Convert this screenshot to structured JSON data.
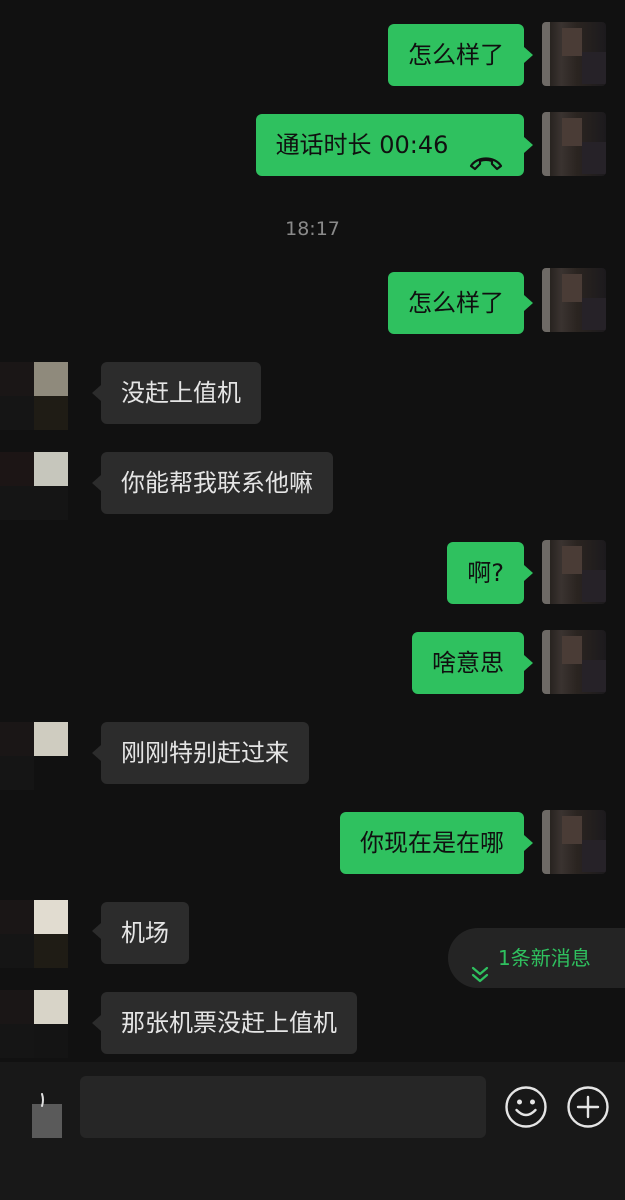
{
  "messages": [
    {
      "side": "sent",
      "text": "怎么样了"
    },
    {
      "side": "sent",
      "text": "通话时长 00:46",
      "icon": "phone-hangup-icon"
    },
    {
      "side": "sent",
      "text": "怎么样了"
    },
    {
      "side": "received",
      "text": "没赶上值机"
    },
    {
      "side": "received",
      "text": "你能帮我联系他嘛"
    },
    {
      "side": "sent",
      "text": "啊?"
    },
    {
      "side": "sent",
      "text": "啥意思"
    },
    {
      "side": "received",
      "text": "刚刚特别赶过来"
    },
    {
      "side": "sent",
      "text": "你现在是在哪"
    },
    {
      "side": "received",
      "text": "机场"
    },
    {
      "side": "received",
      "text": "那张机票没赶上值机"
    }
  ],
  "timestamp": "18:17",
  "new_messages": {
    "label": "1条新消息",
    "icon": "double-chevron-down-icon"
  },
  "input_bar": {
    "value": "",
    "voice_icon": "voice-toggle-icon",
    "emoji_icon": "emoji-icon",
    "add_icon": "plus-icon"
  },
  "colors": {
    "sent_bubble": "#2fc15f",
    "received_bubble": "#2c2c2c",
    "background": "#111111",
    "accent": "#2fc15f"
  }
}
